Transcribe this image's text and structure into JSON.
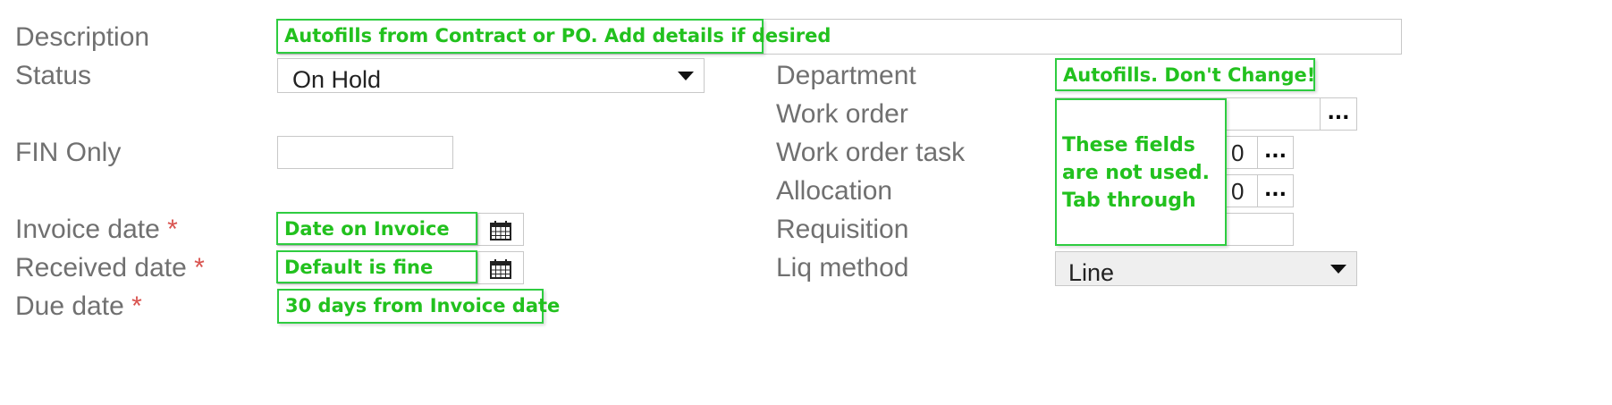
{
  "labels": {
    "description": "Description",
    "status": "Status",
    "fin_only": "FIN Only",
    "invoice_date": "Invoice date",
    "received_date": "Received date",
    "due_date": "Due date",
    "department": "Department",
    "work_order": "Work order",
    "work_order_task": "Work order task",
    "allocation": "Allocation",
    "requisition": "Requisition",
    "liq_method": "Liq method"
  },
  "required_marker": "*",
  "status": {
    "value": "On Hold"
  },
  "liq_method": {
    "value": "Line"
  },
  "work_order_task": {
    "value": "0"
  },
  "allocation": {
    "value": "0"
  },
  "lookup_label": "...",
  "notes": {
    "description": "Autofills from Contract or PO. Add details if desired",
    "department": "Autofills. Don't Change!",
    "unused_fields": "These fields are not used. Tab through",
    "invoice_date": "Date on Invoice",
    "received_date": "Default is fine",
    "due_date": "30 days from Invoice date"
  },
  "colors": {
    "note_green": "#22c11e",
    "note_border": "#2ecc40",
    "required_red": "#d9534f",
    "label_gray": "#707070"
  },
  "icons": {
    "calendar": "calendar-icon",
    "dropdown": "chevron-down-icon"
  }
}
